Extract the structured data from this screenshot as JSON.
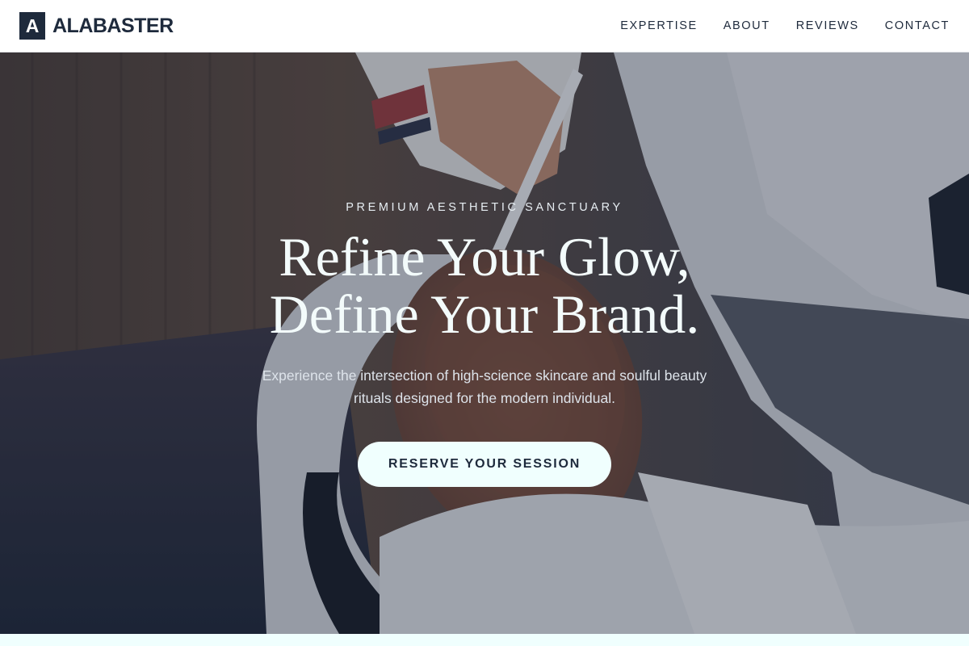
{
  "header": {
    "logo_letter": "A",
    "brand_name": "ALABASTER",
    "nav": [
      {
        "label": "EXPERTISE"
      },
      {
        "label": "ABOUT"
      },
      {
        "label": "REVIEWS"
      },
      {
        "label": "CONTACT"
      }
    ]
  },
  "hero": {
    "eyebrow": "PREMIUM AESTHETIC SANCTUARY",
    "headline_line1": "Refine Your Glow,",
    "headline_line2": "Define Your Brand.",
    "subhead": "Experience the intersection of high-science skincare and soulful beauty rituals designed for the modern individual.",
    "cta_label": "RESERVE YOUR SESSION",
    "background_image": "facial-treatment-photo"
  },
  "colors": {
    "navy": "#1e2a3c",
    "cta_background": "#f0fffe",
    "header_background": "#ffffff"
  }
}
